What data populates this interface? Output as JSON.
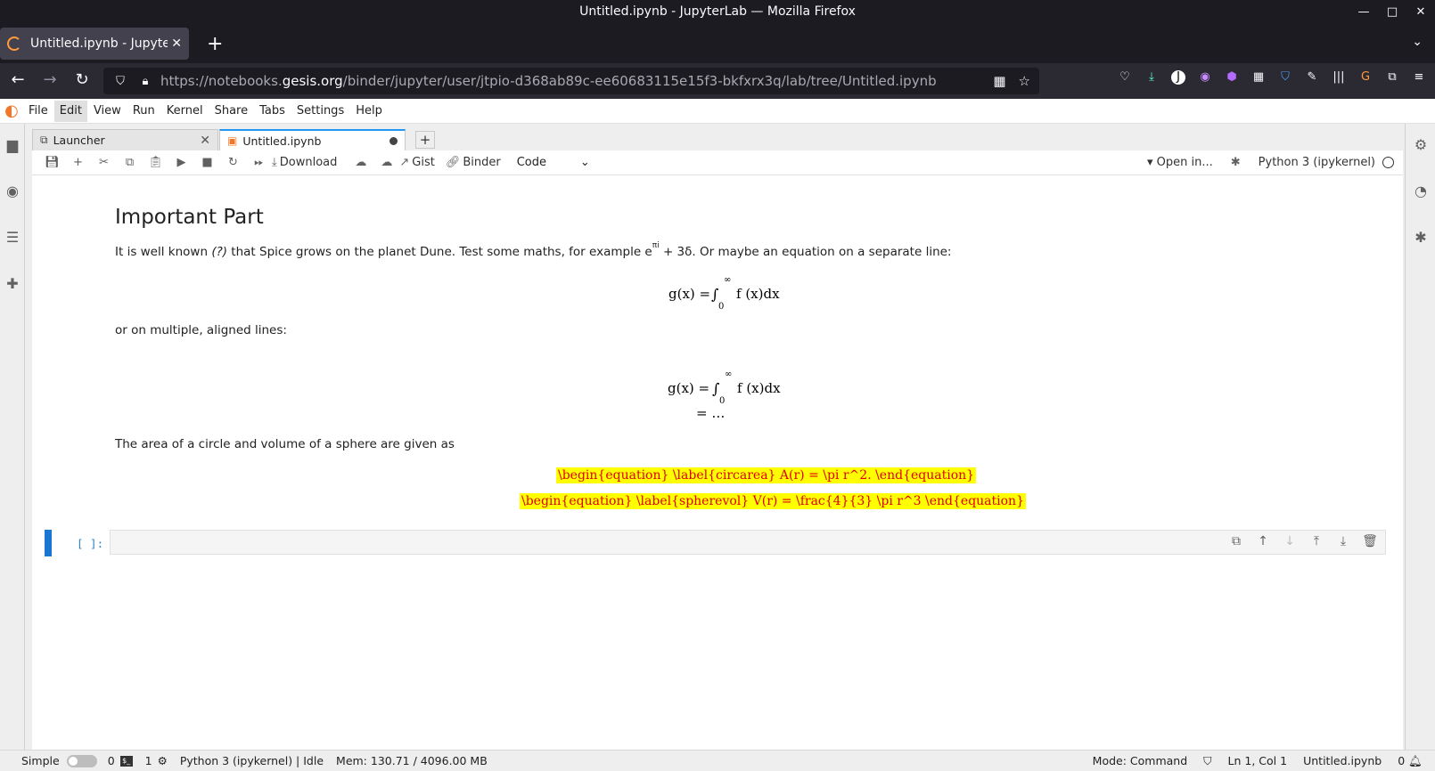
{
  "window": {
    "title": "Untitled.ipynb - JupyterLab — Mozilla Firefox",
    "controls": [
      "—",
      "□",
      "✕"
    ]
  },
  "browser": {
    "tab_label": "Untitled.ipynb - JupyterLa",
    "url_host_prefix": "https://notebooks.",
    "url_host": "gesis.org",
    "url_path": "/binder/jupyter/user/jtpio-d368ab89c-ee60683115e15f3-bkfxrx3q/lab/tree/Untitled.ipynb"
  },
  "menu": [
    "File",
    "Edit",
    "View",
    "Run",
    "Kernel",
    "Share",
    "Tabs",
    "Settings",
    "Help"
  ],
  "doc_tabs": [
    {
      "label": "Launcher"
    },
    {
      "label": "Untitled.ipynb"
    }
  ],
  "toolbar": {
    "download": "Download",
    "gist": "Gist",
    "binder": "Binder",
    "cell_type": "Code",
    "open_in": "Open in...",
    "kernel": "Python 3 (ipykernel)"
  },
  "notebook": {
    "heading": "Important Part",
    "para1_a": "It is well known ",
    "para1_ref": "(?)",
    "para1_b": " that Spice grows on the planet Dune. Test some maths, for example e",
    "para1_sup": "πi",
    "para1_c": " +  3δ. Or maybe an equation on a separate line:",
    "eq1_lhs": "g(x) = ",
    "eq1_integral": "∫",
    "eq1_upper": "∞",
    "eq1_lower": "0",
    "eq1_rhs": "f (x)dx",
    "para2": "or on multiple, aligned lines:",
    "eq2_lhs": "g(x) = ",
    "eq2_integral": "∫",
    "eq2_upper": "∞",
    "eq2_lower": "0",
    "eq2_rhs": "f (x)dx",
    "eq2_line2": "=  …",
    "para3": "The area of a circle and volume of a sphere are given as",
    "err1": "\\begin{equation} \\label{circarea} A(r) = \\pi r^2. \\end{equation}",
    "err2": "\\begin{equation} \\label{spherevol} V(r) = \\frac{4}{3} \\pi r^3 \\end{equation}",
    "prompt": "[ ]:"
  },
  "status": {
    "mode_label": "Simple",
    "terminals": "0",
    "kernels": "1",
    "kernel_status": "Python 3 (ipykernel) | Idle",
    "mem": "Mem: 130.71 / 4096.00 MB",
    "cmd_mode": "Mode: Command",
    "position": "Ln 1, Col 1",
    "filename": "Untitled.ipynb",
    "notifications": "0"
  }
}
